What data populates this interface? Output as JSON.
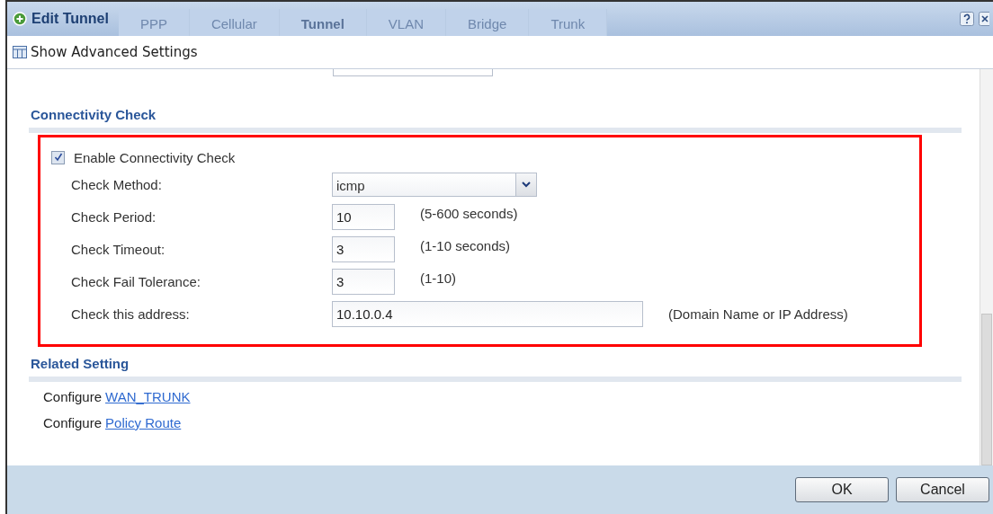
{
  "window": {
    "title": "Edit Tunnel"
  },
  "background_tabs": [
    {
      "label": "PPP",
      "selected": false
    },
    {
      "label": "Cellular",
      "selected": false
    },
    {
      "label": "Tunnel",
      "selected": true
    },
    {
      "label": "VLAN",
      "selected": false
    },
    {
      "label": "Bridge",
      "selected": false
    },
    {
      "label": "Trunk",
      "selected": false
    }
  ],
  "toolbar": {
    "label": "Show Advanced Settings"
  },
  "connectivity_check": {
    "title": "Connectivity Check",
    "highlighted": true,
    "enable": {
      "label": "Enable Connectivity Check",
      "checked": true
    },
    "fields": [
      {
        "kind": "select",
        "label": "Check Method:",
        "value": "icmp"
      },
      {
        "kind": "short",
        "label": "Check Period:",
        "value": "10",
        "hint": "(5-600 seconds)"
      },
      {
        "kind": "short",
        "label": "Check Timeout:",
        "value": "3",
        "hint": "(1-10 seconds)"
      },
      {
        "kind": "short",
        "label": "Check Fail Tolerance:",
        "value": "3",
        "hint": "(1-10)"
      },
      {
        "kind": "long",
        "label": "Check this address:",
        "value": "10.10.0.4",
        "hint": "(Domain Name or IP Address)"
      }
    ]
  },
  "related_setting": {
    "title": "Related Setting",
    "items": [
      {
        "text": "Configure",
        "link": "WAN_TRUNK"
      },
      {
        "text": "Configure",
        "link": "Policy Route"
      }
    ]
  },
  "buttons": [
    {
      "label": "OK"
    },
    {
      "label": "Cancel"
    }
  ]
}
